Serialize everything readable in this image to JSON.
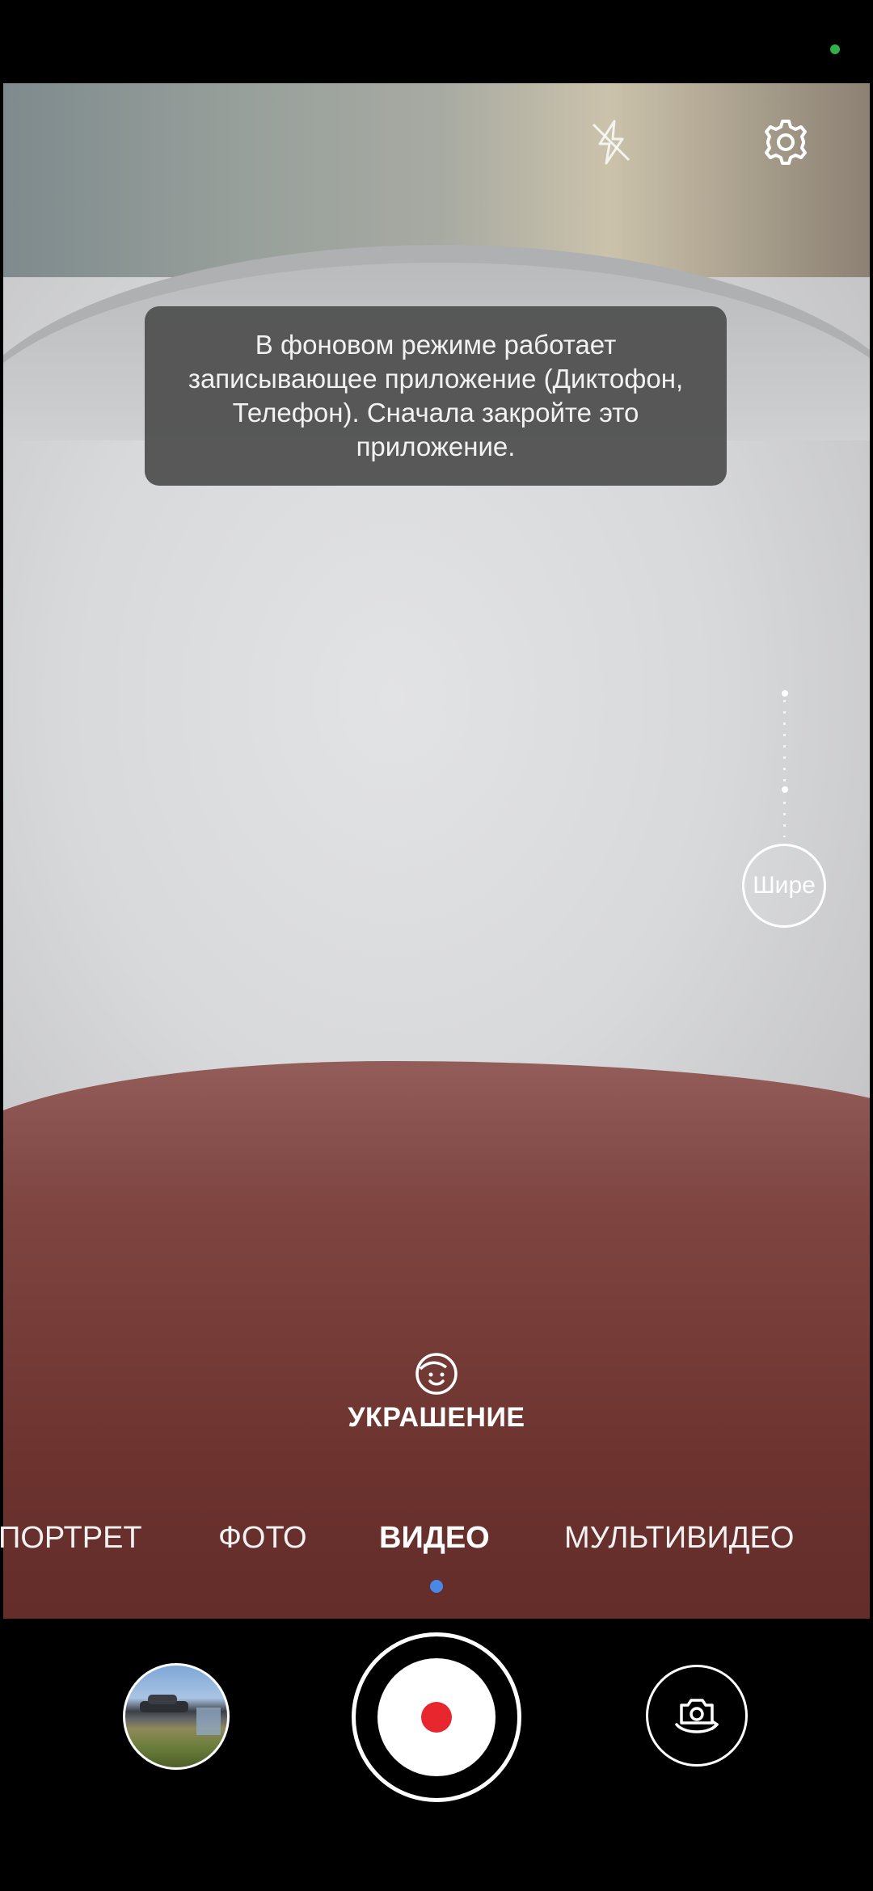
{
  "status_bar": {
    "indicator_color": "#2fb14a"
  },
  "top_controls": {
    "flash_icon": "flash-off-icon",
    "settings_icon": "gear-icon"
  },
  "toast": {
    "message": "В фоновом режиме работает записывающее приложение (Диктофон, Телефон). Сначала закройте это приложение."
  },
  "zoom": {
    "label": "Шире"
  },
  "beauty": {
    "icon": "face-beauty-icon",
    "label": "УКРАШЕНИЕ"
  },
  "modes": {
    "items": [
      {
        "label": "ПОРТРЕТ",
        "active": false
      },
      {
        "label": "ФОТО",
        "active": false
      },
      {
        "label": "ВИДЕО",
        "active": true
      },
      {
        "label": "МУЛЬТИВИДЕО",
        "active": false
      }
    ],
    "indicator_color": "#4a88e8"
  },
  "bottom_bar": {
    "gallery_icon": "gallery-thumbnail",
    "record_color": "#e8262d",
    "switch_icon": "switch-camera-icon"
  }
}
